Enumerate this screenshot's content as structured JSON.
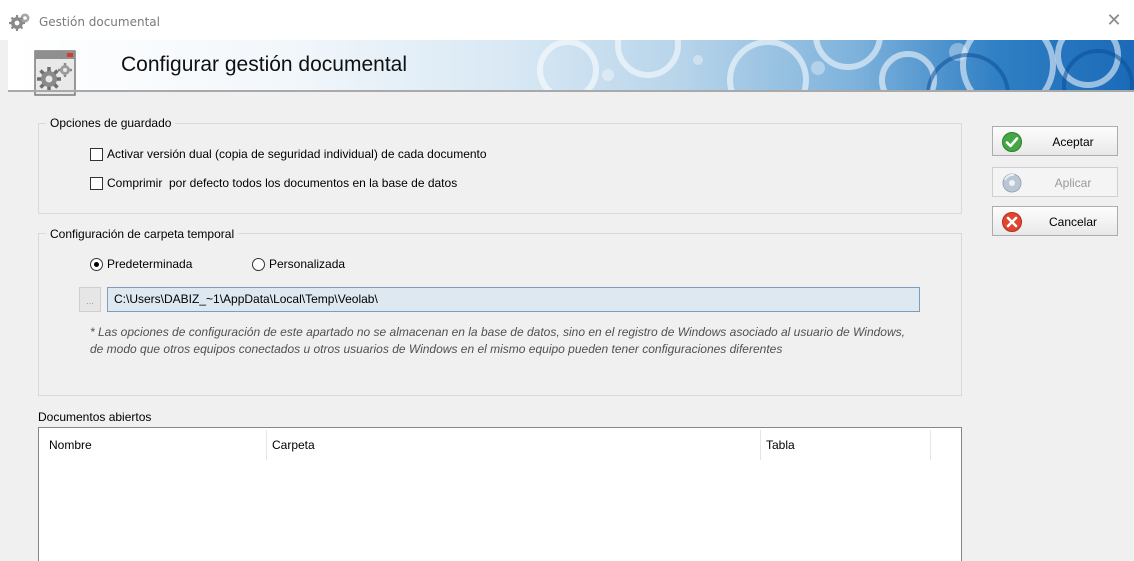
{
  "window": {
    "title": "Gestión documental",
    "close_glyph": "✕"
  },
  "banner": {
    "title": "Configurar gestión documental",
    "icon": "gears-window-icon"
  },
  "save_options": {
    "title": "Opciones de guardado",
    "items": [
      {
        "label": "Activar versión dual (copia de seguridad individual) de cada documento",
        "checked": false
      },
      {
        "label": "Comprimir  por defecto todos los documentos en la base de datos",
        "checked": false
      }
    ]
  },
  "temp_folder": {
    "title": "Configuración de carpeta temporal",
    "options": [
      {
        "label": "Predeterminada",
        "selected": true
      },
      {
        "label": "Personalizada",
        "selected": false
      }
    ],
    "browse_label": "...",
    "path": "C:\\Users\\DABIZ_~1\\AppData\\Local\\Temp\\Veolab\\",
    "note": "* Las opciones de configuración de este apartado no se almacenan en la base de datos, sino en el registro de Windows asociado al usuario de Windows, de modo que otros equipos conectados u otros usuarios de Windows en el mismo equipo pueden tener configuraciones diferentes"
  },
  "open_documents": {
    "title": "Documentos abiertos",
    "columns": [
      "Nombre",
      "Carpeta",
      "Tabla"
    ],
    "rows": []
  },
  "buttons": {
    "accept": {
      "label": "Aceptar",
      "icon": "check-icon",
      "color": "#3aa13a"
    },
    "apply": {
      "label": "Aplicar",
      "icon": "disc-icon",
      "disabled": true
    },
    "cancel": {
      "label": "Cancelar",
      "icon": "cancel-icon",
      "color": "#e0412f"
    }
  }
}
